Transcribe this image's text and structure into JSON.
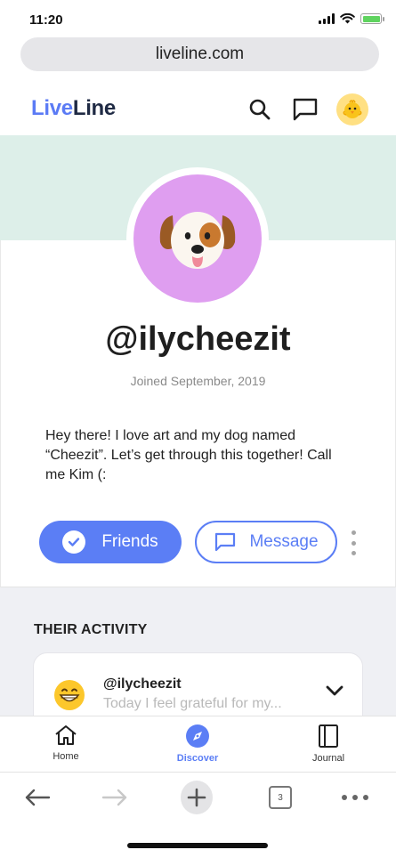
{
  "status_bar": {
    "time": "11:20"
  },
  "browser": {
    "url": "liveline.com",
    "tab_count": "3"
  },
  "header": {
    "logo_part1": "Live",
    "logo_part2": "Line",
    "icons": [
      "search-icon",
      "chat-icon",
      "chick-avatar"
    ]
  },
  "profile": {
    "avatar_icon": "dog-face",
    "username": "@ilycheezit",
    "joined": "Joined September, 2019",
    "bio": "Hey there! I love art and my dog named “Cheezit”. Let’s get through this together! Call me Kim (:",
    "friends_label": "Friends",
    "message_label": "Message"
  },
  "activity": {
    "title": "THEIR ACTIVITY",
    "items": [
      {
        "emoji": "grinning-face",
        "user": "@ilycheezit",
        "preview": "Today I feel grateful for my..."
      }
    ]
  },
  "bottom_nav": {
    "items": [
      {
        "label": "Home",
        "icon": "home-icon",
        "active": false
      },
      {
        "label": "Discover",
        "icon": "compass-icon",
        "active": true
      },
      {
        "label": "Journal",
        "icon": "journal-icon",
        "active": false
      }
    ]
  },
  "colors": {
    "accent": "#5b7ef5",
    "profile_banner": "#ddefe9",
    "avatar_bg": "#df9ef0",
    "activity_bg": "#eff0f4"
  }
}
